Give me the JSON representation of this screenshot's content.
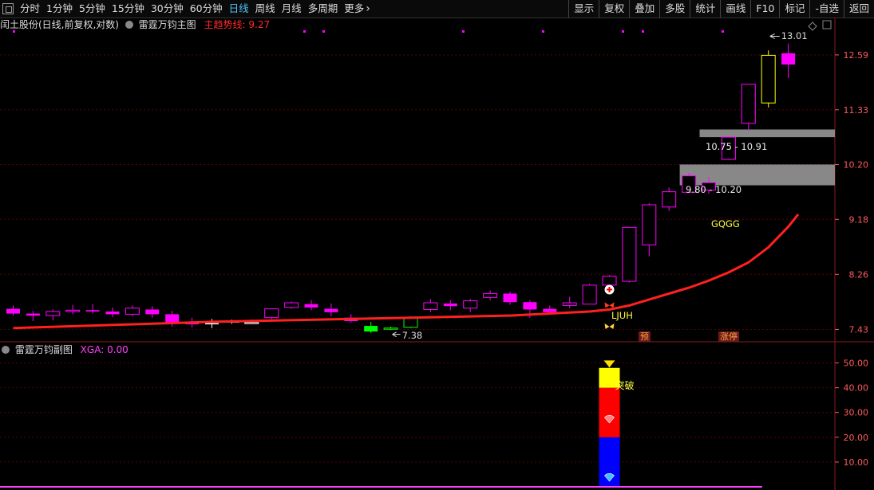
{
  "toolbar": {
    "left": [
      "分时",
      "1分钟",
      "5分钟",
      "15分钟",
      "30分钟",
      "60分钟",
      "日线",
      "周线",
      "月线",
      "多周期",
      "更多"
    ],
    "active_index": 6,
    "right": [
      "显示",
      "复权",
      "叠加",
      "多股",
      "统计",
      "画线",
      "F10",
      "标记",
      "-自选",
      "返回"
    ]
  },
  "main_panel": {
    "stock_title": "闰土股份(日线,前复权,对数)",
    "indicator_name": "雷霆万钧主图",
    "indicator_line_label": "主趋势线:",
    "indicator_line_value": "9.27",
    "y_ticks": [
      "12.59",
      "11.33",
      "10.20",
      "9.18",
      "8.26",
      "7.43"
    ],
    "high_label": "13.01",
    "low_label": "7.38",
    "zone_labels": [
      "10.75 - 10.91",
      "9.80 - 10.20"
    ],
    "text_gqgg": "GQGG",
    "text_ljuh": "LJUH",
    "tag_yu": "预",
    "tag_zhangting": "涨停"
  },
  "sub_panel": {
    "indicator_name": "雷霆万钧副图",
    "xga_label": "XGA:",
    "xga_value": "0.00",
    "y_ticks": [
      "50.00",
      "40.00",
      "30.00",
      "20.00",
      "10.00"
    ],
    "breakout_label": "突破"
  },
  "colors": {
    "up": "#ff00ff",
    "down": "#ff00ff",
    "trend_line": "#ff2020",
    "grid": "#5a0000",
    "axis_text": "#ff5a5a",
    "active_tab": "#4fc3f7",
    "zone": "#888888",
    "yellow": "#ffff00",
    "green": "#00ff00"
  },
  "chart_data": {
    "type": "candlestick",
    "scale": "log",
    "ylim": [
      7.3,
      13.2
    ],
    "candles": [
      [
        7.73,
        7.78,
        7.66,
        7.63
      ],
      [
        7.66,
        7.7,
        7.63,
        7.55
      ],
      [
        7.63,
        7.72,
        7.69,
        7.56
      ],
      [
        7.69,
        7.79,
        7.71,
        7.65
      ],
      [
        7.71,
        7.8,
        7.69,
        7.66
      ],
      [
        7.69,
        7.75,
        7.65,
        7.61
      ],
      [
        7.65,
        7.78,
        7.74,
        7.62
      ],
      [
        7.72,
        7.77,
        7.65,
        7.6
      ],
      [
        7.65,
        7.7,
        7.52,
        7.47
      ],
      [
        7.52,
        7.6,
        7.51,
        7.46
      ],
      [
        7.52,
        7.58,
        7.51,
        7.45
      ],
      [
        7.55,
        7.57,
        7.55,
        7.51
      ],
      [
        7.53,
        7.57,
        7.53,
        7.51
      ],
      [
        7.6,
        7.73,
        7.73,
        7.58
      ],
      [
        7.75,
        7.84,
        7.82,
        7.73
      ],
      [
        7.8,
        7.86,
        7.75,
        7.71
      ],
      [
        7.73,
        7.81,
        7.68,
        7.62
      ],
      [
        7.6,
        7.65,
        7.55,
        7.53
      ],
      [
        7.48,
        7.54,
        7.4,
        7.38
      ],
      [
        7.45,
        7.47,
        7.45,
        7.42
      ],
      [
        7.46,
        7.62,
        7.6,
        7.45
      ],
      [
        7.72,
        7.88,
        7.82,
        7.68
      ],
      [
        7.81,
        7.86,
        7.77,
        7.71
      ],
      [
        7.74,
        7.88,
        7.85,
        7.68
      ],
      [
        7.9,
        8.01,
        7.96,
        7.86
      ],
      [
        7.96,
        7.99,
        7.83,
        7.79
      ],
      [
        7.83,
        7.86,
        7.72,
        7.6
      ],
      [
        7.73,
        7.78,
        7.68,
        7.66
      ],
      [
        7.78,
        7.91,
        7.82,
        7.74
      ],
      [
        7.8,
        8.11,
        8.09,
        7.8
      ],
      [
        8.09,
        8.25,
        8.23,
        8.01
      ],
      [
        8.15,
        9.04,
        9.04,
        8.13
      ],
      [
        8.74,
        9.47,
        9.44,
        8.55
      ],
      [
        9.4,
        9.76,
        9.68,
        9.33
      ],
      [
        9.67,
        10.03,
        9.98,
        9.66
      ],
      [
        9.71,
        9.96,
        9.85,
        9.64
      ],
      [
        10.3,
        10.75,
        10.75,
        10.29
      ],
      [
        11.04,
        11.9,
        11.9,
        10.89
      ],
      [
        11.48,
        12.7,
        12.58,
        11.38
      ],
      [
        12.63,
        12.87,
        12.36,
        12.04
      ]
    ],
    "candle_colors": [
      "m",
      "m",
      "m",
      "m",
      "m",
      "m",
      "m",
      "m",
      "m",
      "m",
      "w",
      "w",
      "w",
      "m",
      "m",
      "m",
      "m",
      "m",
      "g",
      "g",
      "g",
      "m",
      "m",
      "m",
      "m",
      "m",
      "m",
      "m",
      "m",
      "m",
      "m",
      "m",
      "m",
      "m",
      "m",
      "m",
      "m",
      "m",
      "y",
      "m"
    ],
    "trend_line": [
      [
        0,
        7.45
      ],
      [
        10,
        7.54
      ],
      [
        20,
        7.6
      ],
      [
        25,
        7.63
      ],
      [
        27,
        7.66
      ],
      [
        29,
        7.69
      ],
      [
        30,
        7.72
      ],
      [
        31,
        7.78
      ],
      [
        32,
        7.87
      ],
      [
        33,
        7.96
      ],
      [
        34,
        8.05
      ],
      [
        35,
        8.16
      ],
      [
        36,
        8.29
      ],
      [
        37,
        8.45
      ],
      [
        38,
        8.7
      ],
      [
        39,
        9.05
      ],
      [
        39.5,
        9.27
      ]
    ],
    "zones": [
      {
        "label": "10.75 - 10.91",
        "low": 10.75,
        "high": 10.91,
        "from_index": 35
      },
      {
        "label": "9.80 - 10.20",
        "low": 9.8,
        "high": 10.2,
        "from_index": 34
      }
    ],
    "sub_bars": [
      {
        "index": 30,
        "from": 0,
        "to": 20,
        "color": "#0000ff"
      },
      {
        "index": 30,
        "from": 20,
        "to": 40,
        "color": "#ff0000"
      },
      {
        "index": 30,
        "from": 40,
        "to": 48,
        "color": "#ffff00"
      }
    ],
    "sub_ylim": [
      0,
      55
    ]
  }
}
